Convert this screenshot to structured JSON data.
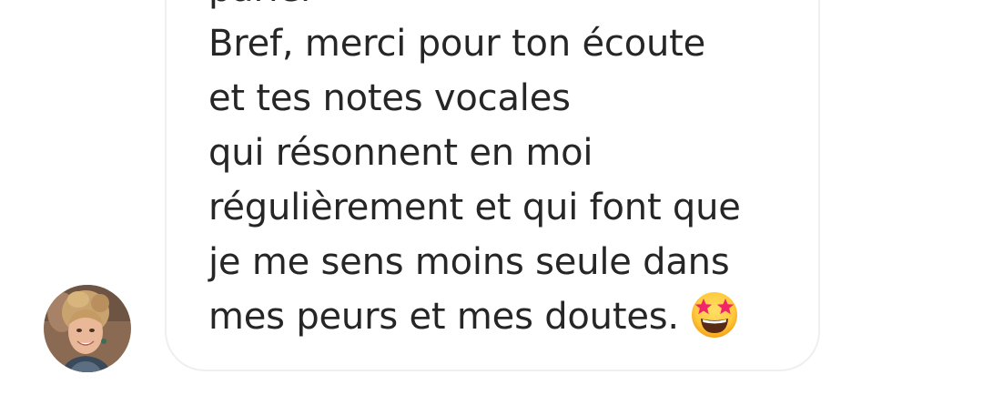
{
  "conversation": {
    "message": {
      "lines": [
        "parler",
        "Bref, merci pour ton écoute",
        "et tes notes vocales",
        "qui résonnent en moi",
        "régulièrement et qui font que",
        "je me sens moins seule dans",
        "mes peurs et mes doutes."
      ],
      "emoji": "star-struck-emoji"
    },
    "sender": {
      "avatar_icon": "profile-photo-avatar"
    }
  },
  "colors": {
    "text": "#262626",
    "bubble_border": "#efefef",
    "background": "#ffffff"
  }
}
